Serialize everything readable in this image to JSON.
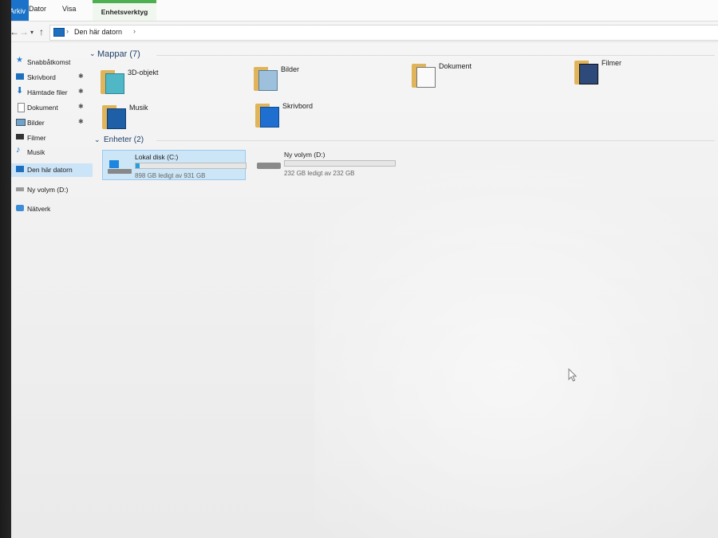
{
  "ribbon": {
    "tabs": [
      {
        "label": "Arkiv"
      },
      {
        "label": "Dator"
      },
      {
        "label": "Visa"
      },
      {
        "label": "Enhetsverktyg"
      }
    ]
  },
  "address": {
    "breadcrumb": "Den här datorn",
    "separator": "›"
  },
  "sidebar": {
    "items": [
      {
        "label": "Snabbåtkomst",
        "icon": "star-icon"
      },
      {
        "label": "Skrivbord",
        "icon": "desktop-folder-icon",
        "pinned": true
      },
      {
        "label": "Hämtade filer",
        "icon": "download-arrow-icon",
        "pinned": true
      },
      {
        "label": "Dokument",
        "icon": "document-icon",
        "pinned": true
      },
      {
        "label": "Bilder",
        "icon": "pictures-icon",
        "pinned": true
      },
      {
        "label": "Filmer",
        "icon": "film-icon"
      },
      {
        "label": "Musik",
        "icon": "music-note-icon"
      },
      {
        "label": "Den här datorn",
        "icon": "computer-icon",
        "selected": true
      },
      {
        "label": "Ny volym (D:)",
        "icon": "drive-icon"
      },
      {
        "label": "Nätverk",
        "icon": "network-icon"
      }
    ]
  },
  "sections": {
    "folders_heading": "Mappar (7)",
    "drives_heading": "Enheter (2)"
  },
  "folders": [
    {
      "label": "3D-objekt",
      "icon": "3d-objects-icon"
    },
    {
      "label": "Bilder",
      "icon": "pictures-icon"
    },
    {
      "label": "Dokument",
      "icon": "document-icon"
    },
    {
      "label": "Filmer",
      "icon": "film-icon"
    },
    {
      "label": "Musik",
      "icon": "music-note-icon"
    },
    {
      "label": "Skrivbord",
      "icon": "desktop-folder-icon"
    }
  ],
  "drives": [
    {
      "label": "Lokal disk (C:)",
      "info": "898 GB ledigt av 931 GB",
      "used_fraction": 0.035,
      "icon": "windows-drive-icon",
      "selected": true
    },
    {
      "label": "Ny volym (D:)",
      "info": "232 GB ledigt av 232 GB",
      "used_fraction": 0.0,
      "icon": "drive-icon"
    }
  ],
  "colors": {
    "accent": "#1a73c8",
    "selection": "#cce4f7",
    "context_tab": "#4caf50",
    "bar_fill": "#26a0da"
  }
}
